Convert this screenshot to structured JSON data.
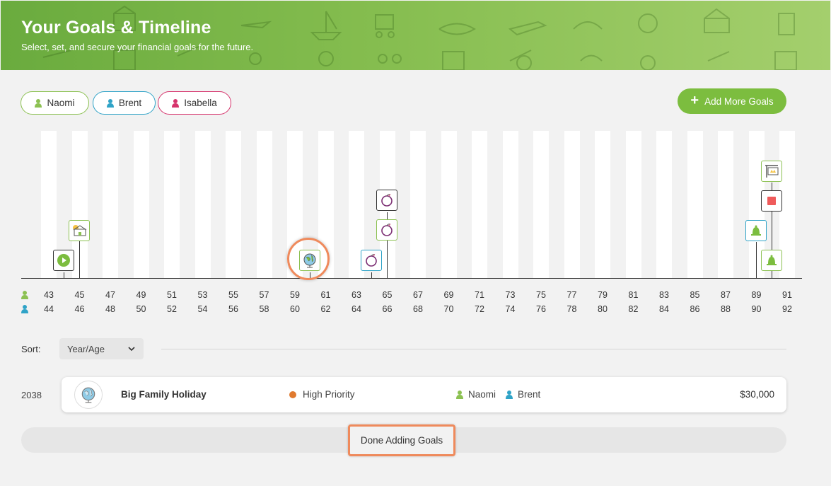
{
  "header": {
    "title": "Your Goals & Timeline",
    "subtitle": "Select, set, and secure your financial goals for the future."
  },
  "people": [
    {
      "name": "Naomi",
      "color": "#8cc152"
    },
    {
      "name": "Brent",
      "color": "#2fa3c7"
    },
    {
      "name": "Isabella",
      "color": "#d6336c"
    }
  ],
  "actions": {
    "add_goals_label": "Add More Goals"
  },
  "timeline": {
    "naomi_ages": [
      "43",
      "45",
      "47",
      "49",
      "51",
      "53",
      "55",
      "57",
      "59",
      "61",
      "63",
      "65",
      "67",
      "69",
      "71",
      "73",
      "75",
      "77",
      "79",
      "81",
      "83",
      "85",
      "87",
      "89",
      "91"
    ],
    "brent_ages": [
      "44",
      "46",
      "48",
      "50",
      "52",
      "54",
      "56",
      "58",
      "60",
      "62",
      "64",
      "66",
      "68",
      "70",
      "72",
      "74",
      "76",
      "78",
      "80",
      "82",
      "84",
      "86",
      "88",
      "90",
      "92"
    ],
    "markers": [
      {
        "icon": "play-icon"
      },
      {
        "icon": "house-icon"
      },
      {
        "icon": "globe-icon"
      },
      {
        "icon": "tuition-apple-icon"
      },
      {
        "icon": "tuition-apple-icon"
      },
      {
        "icon": "tuition-apple-icon"
      },
      {
        "icon": "retirement-bell-icon"
      },
      {
        "icon": "retirement-bell-icon"
      },
      {
        "icon": "stop-icon"
      },
      {
        "icon": "sale-sign-icon"
      }
    ]
  },
  "sort": {
    "label": "Sort:",
    "value": "Year/Age"
  },
  "goals": [
    {
      "year": "2038",
      "icon": "globe-icon",
      "name": "Big Family Holiday",
      "priority": "High Priority",
      "priority_color": "#e07a2f",
      "people": [
        "Naomi",
        "Brent"
      ],
      "amount": "$30,000"
    }
  ],
  "footer": {
    "done_label": "Done Adding Goals"
  }
}
